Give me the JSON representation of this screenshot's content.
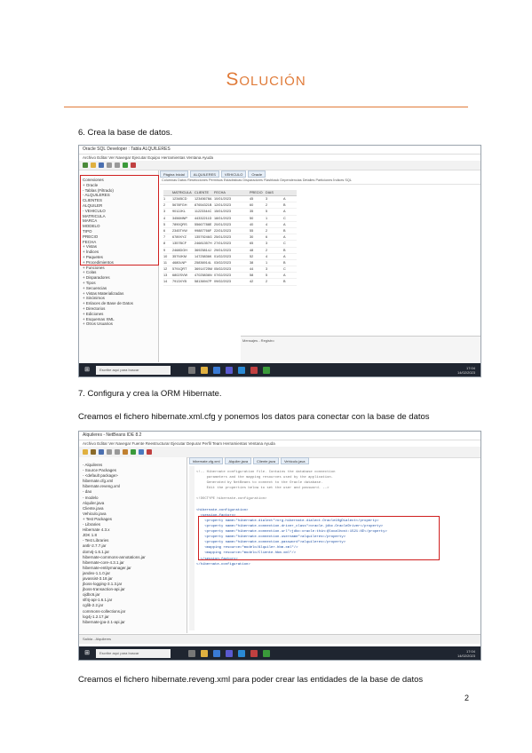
{
  "page": {
    "title": "Solución",
    "page_number": "2"
  },
  "steps": [
    {
      "label": "6.  Crea la base de datos."
    },
    {
      "label": "7.  Configura y crea la ORM Hibernate."
    }
  ],
  "paragraphs": {
    "cfg": "Creamos el fichero hibernate.xml.cfg y ponemos los datos para conectar con la base de datos",
    "reveng": "Creamos el fichero hibernate.reveng.xml para poder crear las entidades de la base de datos"
  },
  "screenshot1": {
    "window_title": "Oracle SQL Developer : Tabla ALQUILERES",
    "menu": "Archivo  Editar  Ver  Navegar  Ejecutar  Equipo  Herramientas  Ventana  Ayuda",
    "left_tree": [
      "Conexiones",
      "+ Oracle",
      "  - Tablas (Filtrado)",
      "    - ALQUILERES",
      "      CLIENTES",
      "      ALQUILER",
      "    - VEHICULO",
      "      MATRICULA",
      "      MARCA",
      "      MODELO",
      "      TIPO",
      "      PRECIO",
      "      FECHA",
      "  + Vistas",
      "  + Índices",
      "  + Paquetes",
      "  + Procedimientos",
      "  + Funciones",
      "  + Colas",
      "  + Disparadores",
      "  + Tipos",
      "  + Secuencias",
      "  + Vistas Materializadas",
      "  + Sinónimos",
      "  + Enlaces de Base de Datos",
      "  + Directorios",
      "  + Ediciones",
      "  + Esquemas XML",
      "  + Otros Usuarios"
    ],
    "tabs": [
      "Página Inicial",
      "ALQUILERES",
      "VEHICULO",
      "Oracle"
    ],
    "sql_bar": "Columnas  Datos  Restricciones  Permisos  Estadísticas  Disparadores  Flashback  Dependencias  Detalles  Particiones  Índices  SQL",
    "columns": [
      "",
      "MATRICULA",
      "CLIENTE",
      "FECHA",
      "PRECIO",
      "DIAS",
      ""
    ],
    "rows": [
      [
        "1",
        "1234BCD",
        "12345678A",
        "10/01/2023",
        "45",
        "3",
        "A"
      ],
      [
        "2",
        "5678FGH",
        "87654321B",
        "12/01/2023",
        "60",
        "2",
        "B"
      ],
      [
        "3",
        "9012JKL",
        "11223344C",
        "15/01/2023",
        "35",
        "5",
        "A"
      ],
      [
        "4",
        "3456MNP",
        "44332211D",
        "18/01/2023",
        "50",
        "1",
        "C"
      ],
      [
        "5",
        "7890QRS",
        "55667788E",
        "20/01/2023",
        "40",
        "4",
        "A"
      ],
      [
        "6",
        "2345TVW",
        "99887766F",
        "22/01/2023",
        "55",
        "2",
        "B"
      ],
      [
        "7",
        "6789XYZ",
        "13579246G",
        "25/01/2023",
        "30",
        "6",
        "A"
      ],
      [
        "8",
        "1357BCF",
        "24681357H",
        "27/01/2023",
        "65",
        "3",
        "C"
      ],
      [
        "9",
        "2468DGH",
        "36925814J",
        "29/01/2023",
        "48",
        "2",
        "B"
      ],
      [
        "10",
        "3579JKM",
        "14725836K",
        "01/02/2023",
        "52",
        "4",
        "A"
      ],
      [
        "11",
        "4680LNP",
        "25836914L",
        "03/02/2023",
        "38",
        "1",
        "B"
      ],
      [
        "12",
        "5791QRT",
        "36914725M",
        "05/02/2023",
        "44",
        "3",
        "C"
      ],
      [
        "13",
        "6802SVW",
        "47025836N",
        "07/02/2023",
        "58",
        "5",
        "A"
      ],
      [
        "14",
        "7913XYB",
        "58136947P",
        "09/02/2023",
        "42",
        "2",
        "B"
      ]
    ],
    "bottom_panel": "Mensajes - Registro",
    "taskbar_search": "Escribe aquí para buscar",
    "tray_time": "17:04",
    "tray_date": "14/02/2023"
  },
  "screenshot2": {
    "window_title": "Alquileres - NetBeans IDE 8.2",
    "menu": "Archivo  Editar  Ver  Navegar  Fuente  Reestructurar  Ejecutar  Depurar  Perfil  Team  Herramientas  Ventana  Ayuda",
    "left_tree": [
      "- Alquileres",
      "  - Source Packages",
      "    - <default package>",
      "        hibernate.cfg.xml",
      "        hibernate.reveng.xml",
      "    - dao",
      "    - modelo",
      "        Alquiler.java",
      "        Cliente.java",
      "        Vehiculo.java",
      "  + Test Packages",
      "  - Libraries",
      "      Hibernate 4.3.x",
      "      JDK 1.8",
      "  - Test Libraries",
      "      antlr-2.7.7.jar",
      "      dom4j-1.6.1.jar",
      "      hibernate-commons-annotations.jar",
      "      hibernate-core-4.3.1.jar",
      "      hibernate-entitymanager.jar",
      "      jandex-1.1.0.jar",
      "      javassist-3.18.jar",
      "      jboss-logging-3.1.3.jar",
      "      jboss-transaction-api.jar",
      "      ojdbc6.jar",
      "      slf4j-api-1.6.1.jar",
      "      cglib-2.2.jar",
      "      commons-collections.jar",
      "      log4j-1.2.17.jar",
      "      hibernate-jpa-2.1-api.jar"
    ],
    "tabs": [
      "hibernate.cfg.xml",
      "Alquiler.java",
      "Cliente.java",
      "Vehiculo.java"
    ],
    "code_comment": [
      "<!-- Hibernate configuration file. Contains the database connection",
      "     parameters and the mapping resources used by the application.",
      "     Generated by NetBeans to connect to the Oracle database.",
      "     Edit the properties below to set the user and password. -->",
      "",
      "<!DOCTYPE hibernate-configuration>"
    ],
    "code_config": [
      "<hibernate-configuration>",
      "  <session-factory>",
      "    <property name=\"hibernate.dialect\">org.hibernate.dialect.Oracle10gDialect</property>",
      "    <property name=\"hibernate.connection.driver_class\">oracle.jdbc.OracleDriver</property>",
      "    <property name=\"hibernate.connection.url\">jdbc:oracle:thin:@localhost:1521:XE</property>",
      "    <property name=\"hibernate.connection.username\">alquileres</property>",
      "    <property name=\"hibernate.connection.password\">alquileres</property>",
      "    <mapping resource=\"modelo/Alquiler.hbm.xml\"/>",
      "    <mapping resource=\"modelo/Cliente.hbm.xml\"/>",
      "  </session-factory>",
      "</hibernate-configuration>"
    ],
    "status": "Salida - Alquileres",
    "taskbar_search": "Escribe aquí para buscar"
  },
  "colors": {
    "accent": "#e07b39",
    "highlight_box": "#d02020",
    "taskbar": "#1f2530"
  }
}
